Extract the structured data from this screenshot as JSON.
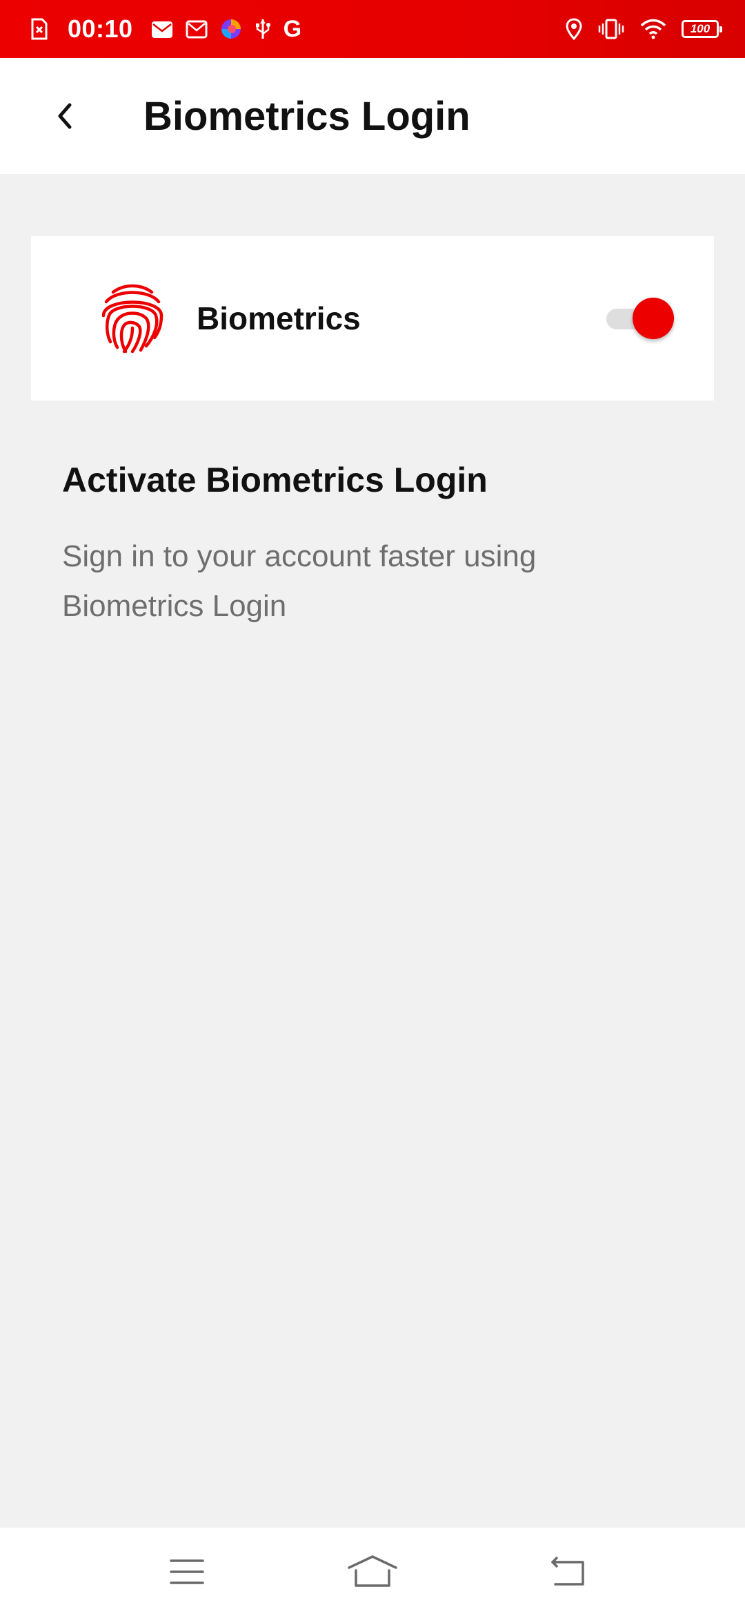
{
  "status_bar": {
    "time": "00:10",
    "battery": "100",
    "google_glyph": "G",
    "left_icons": [
      "sim-error-icon",
      "mail-icon",
      "message-icon",
      "browser-icon",
      "usb-icon",
      "google-icon"
    ],
    "right_icons": [
      "location-icon",
      "vibrate-icon",
      "wifi-icon",
      "battery-icon"
    ],
    "background_color": "#e60000"
  },
  "header": {
    "title": "Biometrics Login",
    "back_icon": "back-chevron-icon"
  },
  "biometrics_card": {
    "icon": "fingerprint-icon",
    "label": "Biometrics",
    "toggle_on": true,
    "accent_color": "#ec0000"
  },
  "info": {
    "title": "Activate Biometrics Login",
    "description": "Sign in to your account faster using Biometrics Login"
  },
  "nav_bar": {
    "buttons": [
      "menu-icon",
      "home-icon",
      "back-icon"
    ]
  }
}
